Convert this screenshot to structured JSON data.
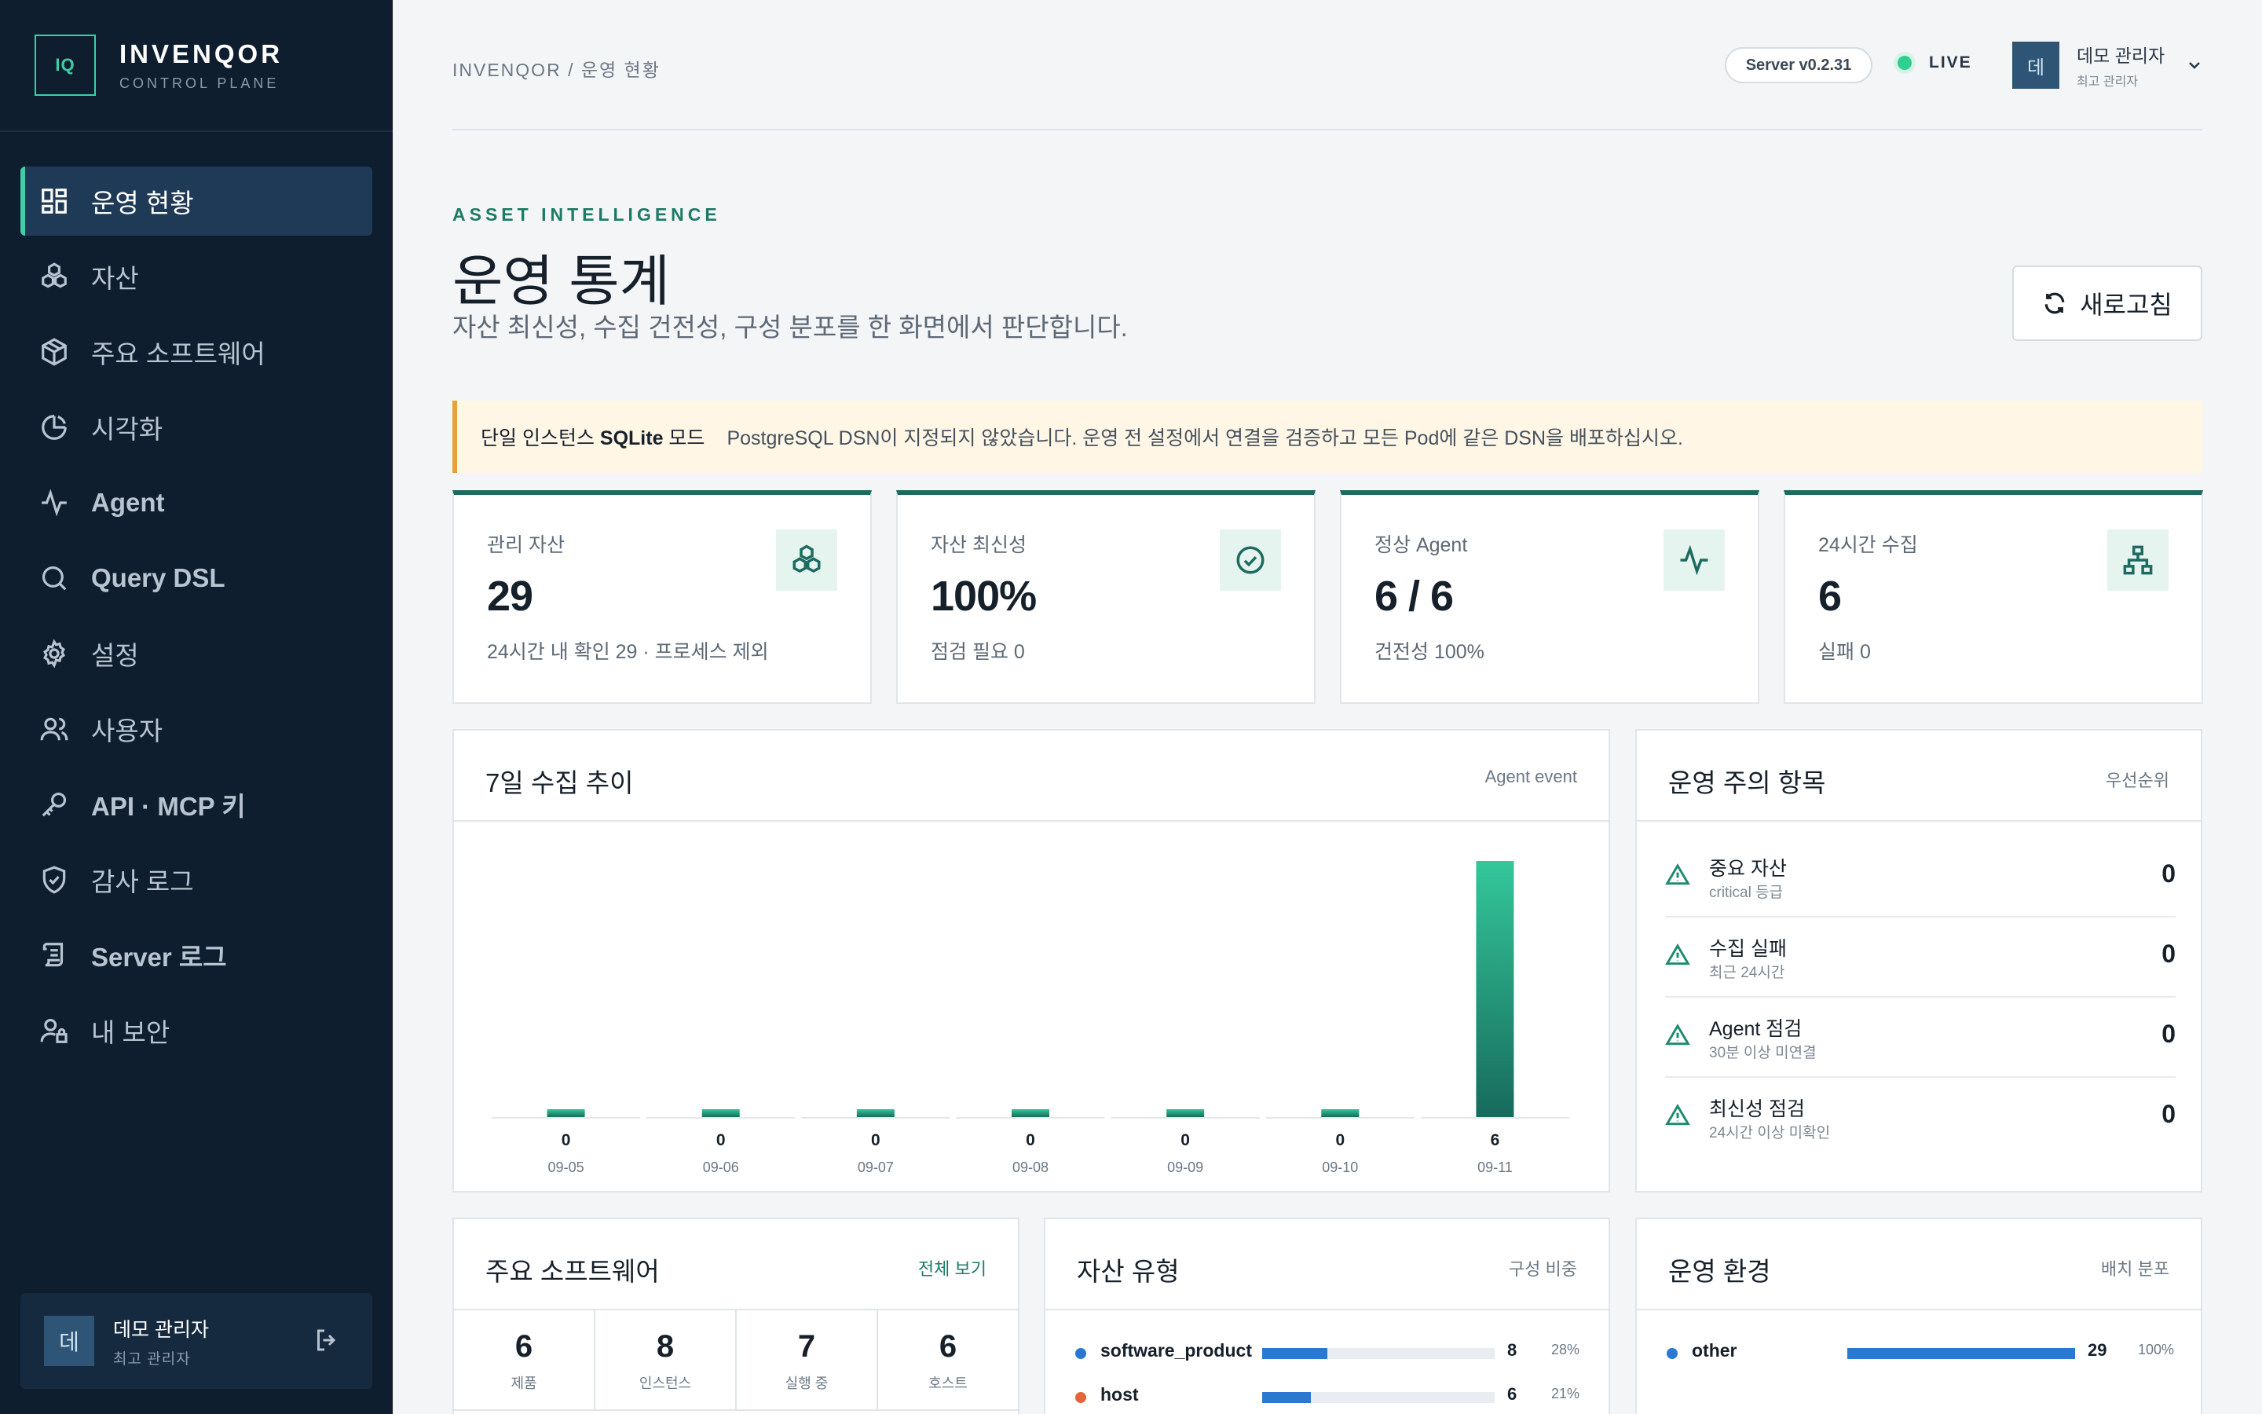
{
  "brand": {
    "logo": "IQ",
    "name": "INVENQOR",
    "subtitle": "CONTROL PLANE"
  },
  "sidebar": {
    "items": [
      {
        "label": "운영 현황",
        "icon": "dashboard-grid-icon",
        "active": true
      },
      {
        "label": "자산",
        "icon": "cubes-icon",
        "active": false
      },
      {
        "label": "주요 소프트웨어",
        "icon": "package-icon",
        "active": false
      },
      {
        "label": "시각화",
        "icon": "pie-chart-icon",
        "active": false
      },
      {
        "label": "Agent",
        "icon": "activity-icon",
        "active": false
      },
      {
        "label": "Query DSL",
        "icon": "search-icon",
        "active": false
      },
      {
        "label": "설정",
        "icon": "gear-icon",
        "active": false
      },
      {
        "label": "사용자",
        "icon": "users-icon",
        "active": false
      },
      {
        "label": "API · MCP 키",
        "icon": "key-icon",
        "active": false
      },
      {
        "label": "감사 로그",
        "icon": "shield-check-icon",
        "active": false
      },
      {
        "label": "Server 로그",
        "icon": "scroll-icon",
        "active": false
      },
      {
        "label": "내 보안",
        "icon": "user-lock-icon",
        "active": false
      }
    ],
    "user": {
      "avatar": "데",
      "name": "데모 관리자",
      "role": "최고 관리자"
    }
  },
  "topbar": {
    "breadcrumb": "INVENQOR / 운영 현황",
    "server_version": "Server v0.2.31",
    "live_label": "LIVE",
    "user": {
      "avatar": "데",
      "name": "데모 관리자",
      "role": "최고 관리자"
    }
  },
  "header": {
    "eyebrow": "ASSET INTELLIGENCE",
    "title": "운영 통계",
    "subtitle": "자산 최신성, 수집 건전성, 구성 분포를 한 화면에서 판단합니다.",
    "refresh_label": "새로고침"
  },
  "alert": {
    "title": "단일 인스턴스 SQLite 모드",
    "message": "PostgreSQL DSN이 지정되지 않았습니다. 운영 전 설정에서 연결을 검증하고 모든 Pod에 같은 DSN을 배포하십시오."
  },
  "kpis": [
    {
      "label": "관리 자산",
      "value": "29",
      "foot": "24시간 내 확인 29 · 프로세스 제외",
      "icon": "cubes-icon"
    },
    {
      "label": "자산 최신성",
      "value": "100%",
      "foot": "점검 필요 0",
      "icon": "check-circle-icon"
    },
    {
      "label": "정상 Agent",
      "value": "6 / 6",
      "foot": "건전성 100%",
      "icon": "activity-icon"
    },
    {
      "label": "24시간 수집",
      "value": "6",
      "foot": "실패 0",
      "icon": "network-icon"
    }
  ],
  "trend_panel": {
    "title": "7일 수집 추이",
    "meta": "Agent event"
  },
  "chart_data": {
    "type": "bar",
    "categories": [
      "09-05",
      "09-06",
      "09-07",
      "09-08",
      "09-09",
      "09-10",
      "09-11"
    ],
    "values": [
      0,
      0,
      0,
      0,
      0,
      0,
      6
    ],
    "title": "7일 수집 추이",
    "xlabel": "",
    "ylabel": "",
    "ylim": [
      0,
      6
    ],
    "grid": false,
    "colors": {
      "bar_top": "#34c79a",
      "bar_bottom": "#176b5c"
    }
  },
  "attention_panel": {
    "title": "운영 주의 항목",
    "meta": "우선순위",
    "items": [
      {
        "title": "중요 자산",
        "sub": "critical 등급",
        "count": "0"
      },
      {
        "title": "수집 실패",
        "sub": "최근 24시간",
        "count": "0"
      },
      {
        "title": "Agent 점검",
        "sub": "30분 이상 미연결",
        "count": "0"
      },
      {
        "title": "최신성 점검",
        "sub": "24시간 이상 미확인",
        "count": "0"
      }
    ]
  },
  "software_panel": {
    "title": "주요 소프트웨어",
    "link": "전체 보기",
    "stats": [
      {
        "value": "6",
        "label": "제품"
      },
      {
        "value": "8",
        "label": "인스턴스"
      },
      {
        "value": "7",
        "label": "실행 중"
      },
      {
        "value": "6",
        "label": "호스트"
      }
    ]
  },
  "asset_type_panel": {
    "title": "자산 유형",
    "meta": "구성 비중",
    "rows": [
      {
        "name": "software_product",
        "count": "8",
        "pct": "28%",
        "ratio": 0.28,
        "dot": "#2a78d0"
      },
      {
        "name": "host",
        "count": "6",
        "pct": "21%",
        "ratio": 0.21,
        "dot": "#e2663a"
      }
    ]
  },
  "env_panel": {
    "title": "운영 환경",
    "meta": "배치 분포",
    "rows": [
      {
        "name": "other",
        "count": "29",
        "pct": "100%",
        "ratio": 1.0,
        "dot": "#2a78d0"
      }
    ]
  },
  "colors": {
    "accent": "#3ecfa6",
    "sidebar_bg": "#0f1e2e",
    "brand_teal": "#1d6b60",
    "warning": "#e8a13a",
    "bar_blue": "#2a78d0"
  }
}
